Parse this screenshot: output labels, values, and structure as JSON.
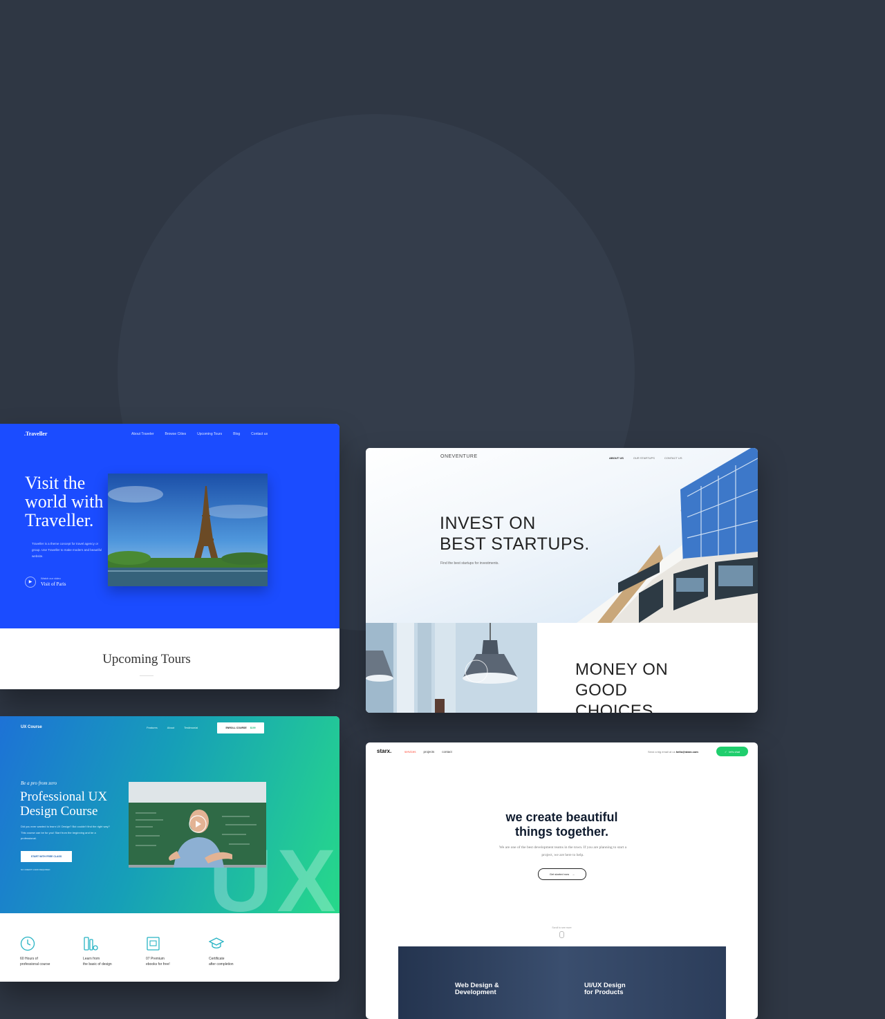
{
  "traveller": {
    "logo": ".Traveller",
    "nav": [
      "About Traveler",
      "Browse Cities",
      "Upcoming Tours",
      "Blog",
      "Contact us"
    ],
    "headline": "Visit the world with Traveller.",
    "description": "Traveller is a theme concept for travel agency or group. Use Traveller to make modern and beautiful website.",
    "watch_small": "Watch our video",
    "watch_large": "Visit of Paris",
    "section_title": "Upcoming Tours"
  },
  "oneventure": {
    "logo": "ONEVENTURE",
    "nav": [
      "ABOUT US",
      "OUR STARTUPS",
      "CONTACT US"
    ],
    "headline_line1": "INVEST ON",
    "headline_line2": "BEST STARTUPS.",
    "subtitle": "Find the best startups for investments.",
    "second_line1": "MONEY ON",
    "second_line2": "GOOD",
    "second_line3": "CHOICES"
  },
  "ux_course": {
    "logo": "UX Course",
    "nav": [
      "Features",
      "About",
      "Testimonial"
    ],
    "enroll_label": "ENROLL COURSE",
    "enroll_price": "$199",
    "kicker": "Be a pro from zero",
    "headline_line1": "Professional UX",
    "headline_line2": "Design Course",
    "description": "Did you ever wanted to learn UX Design? But couldn't find the right way? This course can be for you! Start from the beginning and be a professional.",
    "start_button": "START WITH FREE CLASS",
    "no_card": "NO CREDIT CARD REQUIRED",
    "big_text": "UX",
    "features": [
      {
        "line1": "60 Hours of",
        "line2": "professional course",
        "icon": "clock-icon"
      },
      {
        "line1": "Learn from",
        "line2": "the basic of design",
        "icon": "tools-icon"
      },
      {
        "line1": "07 Premium",
        "line2": "ebooks for free!",
        "icon": "ebook-icon"
      },
      {
        "line1": "Certificate",
        "line2": "after completion",
        "icon": "graduation-cap-icon"
      }
    ],
    "accent": "#21c07a"
  },
  "starx": {
    "logo": "starx.",
    "nav": [
      "services",
      "projects",
      "contact"
    ],
    "mail_label": "Send a big email at us",
    "mail_address": "hello@starx.com",
    "lets_chat": "let's chat",
    "headline_line1": "we create beautiful",
    "headline_line2": "things together.",
    "description": "We are one of the best development teams in the town. If you are planning to start a project, we are here to help.",
    "cta": "Get started now",
    "scroll_hint": "Scroll to see more",
    "services": [
      {
        "line1": "Web Design &",
        "line2": "Development"
      },
      {
        "line1": "UI/UX Design",
        "line2": "for Products"
      }
    ],
    "accent": "#1fce6d"
  }
}
